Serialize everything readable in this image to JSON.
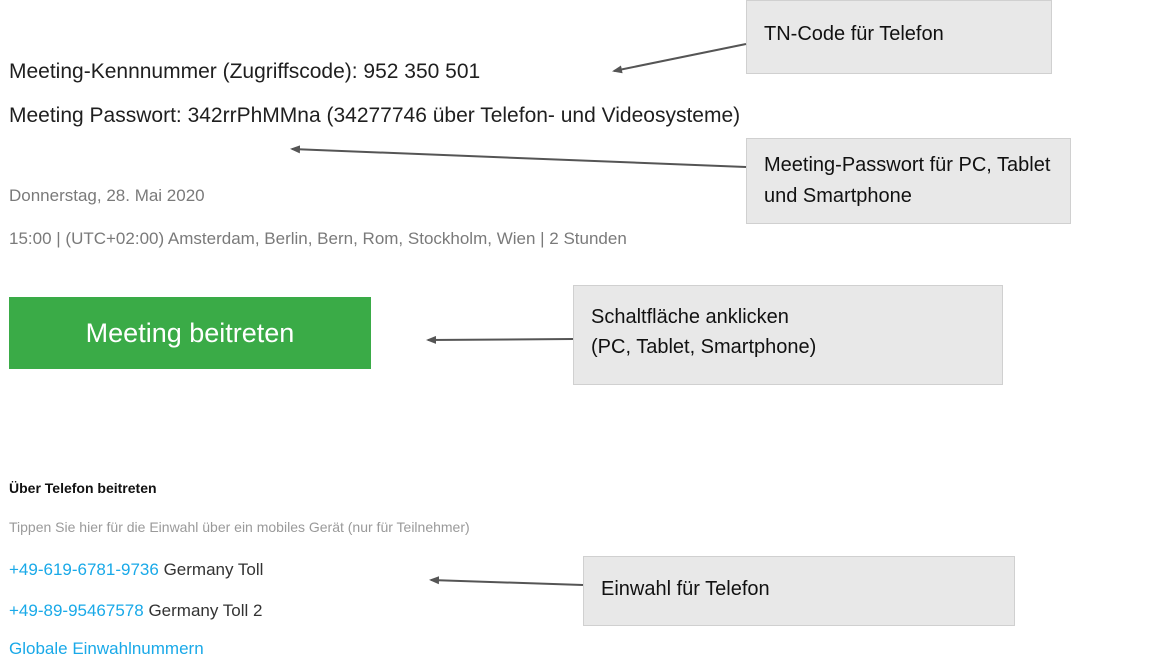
{
  "meeting": {
    "id_line": "Meeting-Kennnummer (Zugriffscode): 952 350 501",
    "password_line": "Meeting Passwort: 342rrPhMMna (34277746 über Telefon- und Videosysteme)",
    "date": "Donnerstag, 28. Mai 2020",
    "time_line": "15:00  |  (UTC+02:00) Amsterdam, Berlin, Bern, Rom, Stockholm, Wien  |  2 Stunden",
    "join_button_label": "Meeting beitreten"
  },
  "phone": {
    "heading": "Über Telefon beitreten",
    "hint": "Tippen Sie hier für die Einwahl über ein mobiles Gerät (nur für Teilnehmer)",
    "dial_in": [
      {
        "number": "+49-619-6781-9736",
        "label": "Germany Toll"
      },
      {
        "number": "+49-89-95467578",
        "label": "Germany Toll 2"
      }
    ],
    "global_link": "Globale Einwahlnummern"
  },
  "callouts": {
    "tn_code": "TN-Code für Telefon",
    "password_line1": "Meeting-Passwort für PC, Tablet",
    "password_line2": "und Smartphone",
    "button_line1": "Schaltfläche anklicken",
    "button_line2": "(PC, Tablet, Smartphone)",
    "dialin": "Einwahl für Telefon"
  },
  "colors": {
    "join_button": "#3aab47",
    "link": "#19a9e8",
    "callout_bg": "#e8e8e8"
  }
}
